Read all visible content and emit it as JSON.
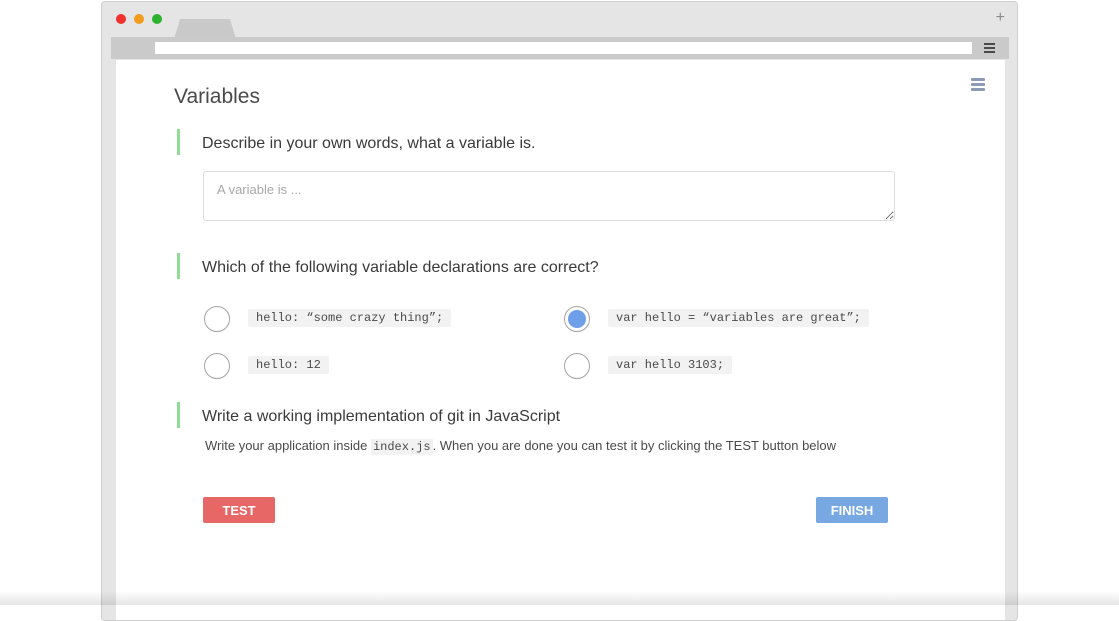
{
  "browser": {
    "traffic_lights": [
      "close",
      "minimize",
      "maximize"
    ],
    "new_tab_symbol": "+",
    "address_bar_value": ""
  },
  "page": {
    "title": "Variables",
    "menu_icon": "hamburger-icon"
  },
  "questions": [
    {
      "text": "Describe in your own words, what a variable is.",
      "answer_placeholder": "A variable is ...",
      "answer_value": ""
    },
    {
      "text": "Which of the following variable declarations are correct?",
      "options": [
        {
          "code": "hello: “some crazy thing”;",
          "selected": false
        },
        {
          "code": "var hello = “variables are great”;",
          "selected": true
        },
        {
          "code": "hello: 12",
          "selected": false
        },
        {
          "code": "var hello 3103;",
          "selected": false
        }
      ]
    },
    {
      "text": "Write a working implementation of git in JavaScript",
      "description_before": "Write your application inside ",
      "description_code": "index.js",
      "description_after": ". When you are done you can test it by clicking the TEST button below"
    }
  ],
  "buttons": {
    "test_label": "TEST",
    "finish_label": "FINISH"
  },
  "colors": {
    "accent_green": "#8fdc94",
    "selected_blue": "#6f9fe8",
    "test_red": "#e76767",
    "finish_blue": "#77a8e2"
  }
}
